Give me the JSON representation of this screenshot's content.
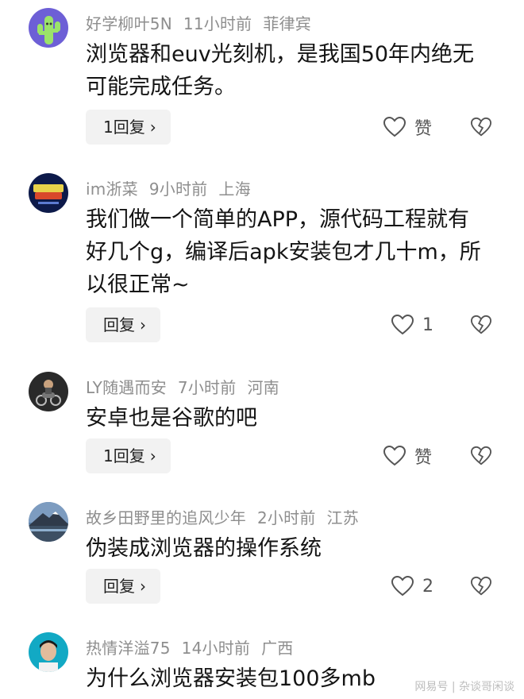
{
  "comments": [
    {
      "user": "好学柳叶5N",
      "time": "11小时前",
      "location": "菲律宾",
      "text": "浏览器和euv光刻机，是我国50年内绝无可能完成任务。",
      "reply_label": "1回复",
      "like_label": "赞",
      "avatar_icon": "cactus-icon"
    },
    {
      "user": "im浙菜",
      "time": "9小时前",
      "location": "上海",
      "text": "我们做一个简单的APP，源代码工程就有好几个g，编译后apk安装包才几十m，所以很正常~",
      "reply_label": "回复",
      "like_label": "1",
      "avatar_icon": "street-fighter-icon"
    },
    {
      "user": "LY随遇而安",
      "time": "7小时前",
      "location": "河南",
      "text": "安卓也是谷歌的吧",
      "reply_label": "1回复",
      "like_label": "赞",
      "avatar_icon": "motorcycle-icon"
    },
    {
      "user": "故乡田野里的追风少年",
      "time": "2小时前",
      "location": "江苏",
      "text": "伪装成浏览器的操作系统",
      "reply_label": "回复",
      "like_label": "2",
      "avatar_icon": "mountain-icon"
    },
    {
      "user": "热情洋溢75",
      "time": "14小时前",
      "location": "广西",
      "text": "为什么浏览器安装包100多mb",
      "avatar_icon": "person-photo-icon"
    }
  ],
  "watermark": "网易号 | 杂谈哥闲谈",
  "colors": {
    "meta_text": "#8e8e8e",
    "button_bg": "#f2f2f2",
    "icon_stroke": "#555555"
  }
}
